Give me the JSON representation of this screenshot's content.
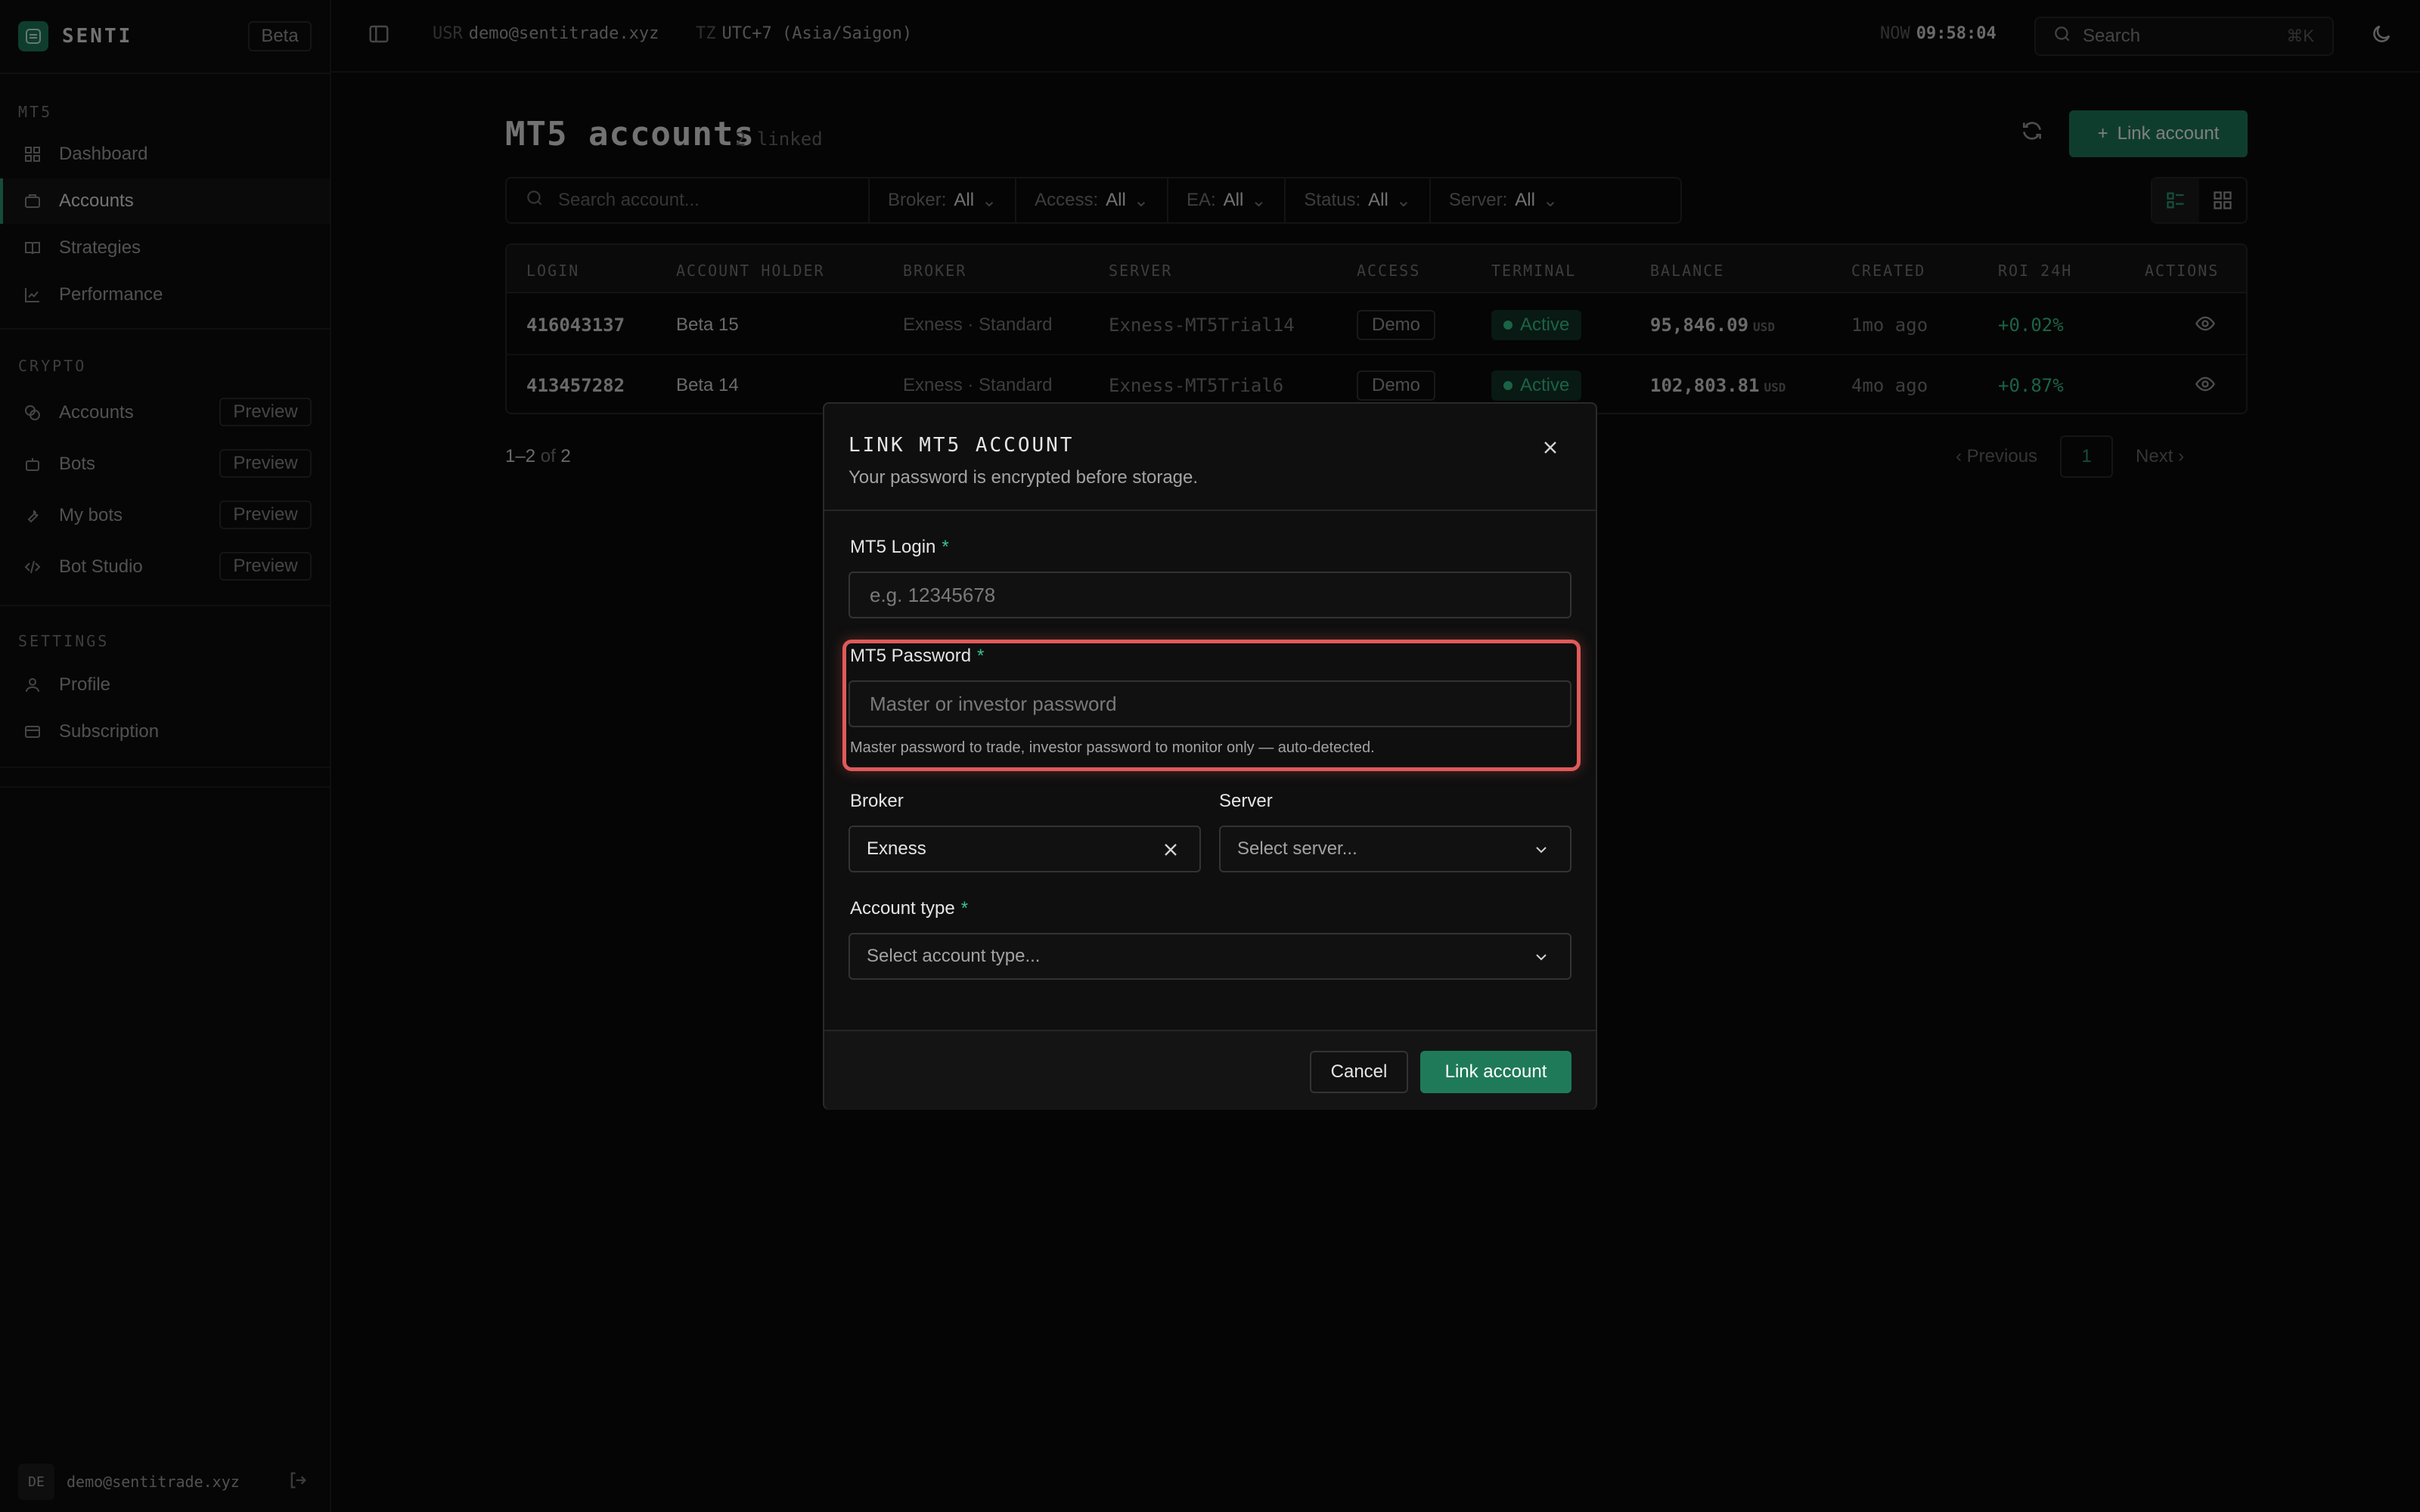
{
  "app": {
    "name": "SENTI",
    "badge": "Beta"
  },
  "sidebar": {
    "sections": [
      {
        "title": "MT5",
        "items": [
          {
            "label": "Dashboard",
            "icon": "grid-icon"
          },
          {
            "label": "Accounts",
            "icon": "briefcase-icon",
            "active": true
          },
          {
            "label": "Strategies",
            "icon": "book-icon"
          },
          {
            "label": "Performance",
            "icon": "chart-line-icon"
          }
        ]
      },
      {
        "title": "CRYPTO",
        "items": [
          {
            "label": "Accounts",
            "icon": "coins-icon",
            "badge": "Preview"
          },
          {
            "label": "Bots",
            "icon": "bot-icon",
            "badge": "Preview"
          },
          {
            "label": "My bots",
            "icon": "wrench-icon",
            "badge": "Preview"
          },
          {
            "label": "Bot Studio",
            "icon": "code-icon",
            "badge": "Preview"
          }
        ]
      },
      {
        "title": "SETTINGS",
        "items": [
          {
            "label": "Profile",
            "icon": "user-icon"
          },
          {
            "label": "Subscription",
            "icon": "card-icon"
          }
        ]
      }
    ],
    "user": {
      "initials": "DE",
      "email": "demo@sentitrade.xyz"
    }
  },
  "topbar": {
    "usr_key": "USR",
    "usr_val": "demo@sentitrade.xyz",
    "tz_key": "TZ",
    "tz_val": "UTC+7 (Asia/Saigon)",
    "now_key": "NOW",
    "now_val": "09:58:04",
    "search_placeholder": "Search",
    "search_kbd": "⌘K"
  },
  "main": {
    "title": "MT5 accounts",
    "subtitle": "2 linked",
    "link_button": "Link account",
    "search_placeholder": "Search account...",
    "filters": [
      {
        "key": "Broker:",
        "value": "All"
      },
      {
        "key": "Access:",
        "value": "All"
      },
      {
        "key": "EA:",
        "value": "All"
      },
      {
        "key": "Status:",
        "value": "All"
      },
      {
        "key": "Server:",
        "value": "All"
      }
    ],
    "columns": [
      "LOGIN",
      "ACCOUNT HOLDER",
      "BROKER",
      "SERVER",
      "ACCESS",
      "TERMINAL",
      "BALANCE",
      "CREATED",
      "ROI 24H",
      "ACTIONS"
    ],
    "rows": [
      {
        "login": "416043137",
        "holder": "Beta 15",
        "broker": "Exness · Standard",
        "server": "Exness-MT5Trial14",
        "access": "Demo",
        "terminal": "Active",
        "balance": "95,846.09",
        "currency": "USD",
        "created": "1mo ago",
        "roi": "+0.02%"
      },
      {
        "login": "413457282",
        "holder": "Beta 14",
        "broker": "Exness · Standard",
        "server": "Exness-MT5Trial6",
        "access": "Demo",
        "terminal": "Active",
        "balance": "102,803.81",
        "currency": "USD",
        "created": "4mo ago",
        "roi": "+0.87%"
      }
    ],
    "pager": {
      "range": "1–2",
      "of": "of",
      "total": "2",
      "prev": "Previous",
      "page": "1",
      "next": "Next"
    }
  },
  "modal": {
    "title": "LINK MT5 ACCOUNT",
    "description": "Your password is encrypted before storage.",
    "login_label": "MT5 Login",
    "login_placeholder": "e.g. 12345678",
    "password_label": "MT5 Password",
    "password_placeholder": "Master or investor password",
    "password_hint": "Master password to trade, investor password to monitor only — auto-detected.",
    "broker_label": "Broker",
    "broker_value": "Exness",
    "server_label": "Server",
    "server_placeholder": "Select server...",
    "type_label": "Account type",
    "type_placeholder": "Select account type...",
    "required_mark": "*",
    "cancel": "Cancel",
    "submit": "Link account"
  },
  "colors": {
    "accent": "#1f7a5a",
    "positive": "#36c48c",
    "highlight": "#e05a5a"
  }
}
